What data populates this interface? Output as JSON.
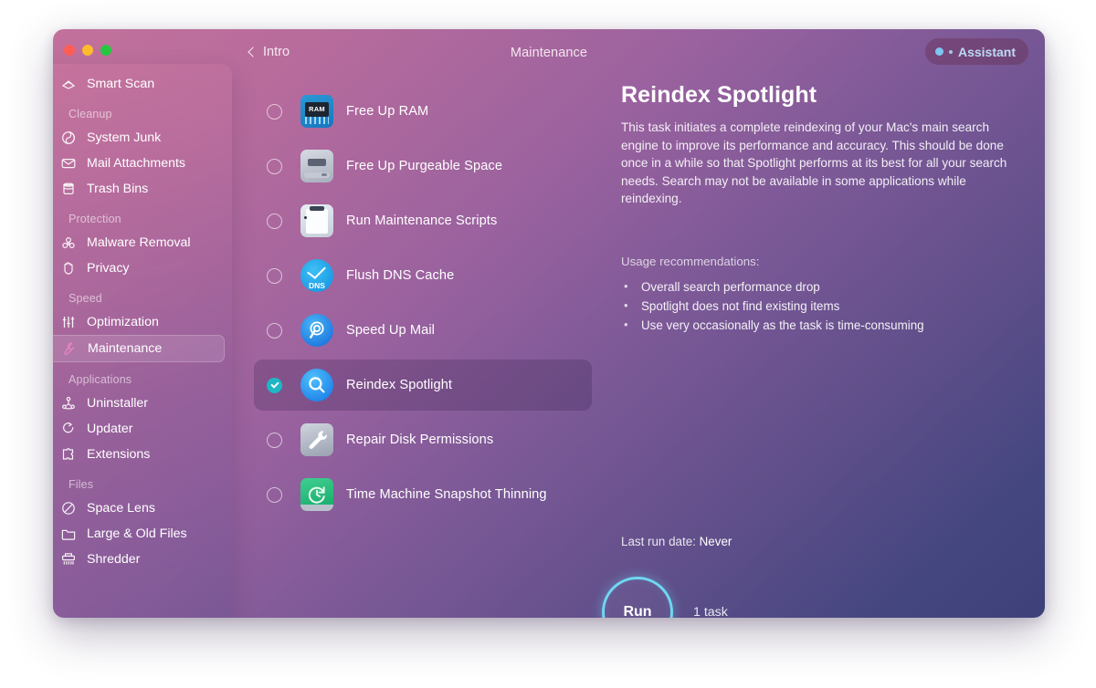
{
  "window": {
    "title": "Maintenance",
    "back_label": "Intro",
    "assistant_label": "Assistant",
    "traffic_lights": [
      "close-button",
      "minimize-button",
      "zoom-button"
    ],
    "accent_color": "#6fd7f2",
    "checkbox_color": "#1fb6c6"
  },
  "sidebar": {
    "top_item": {
      "label": "Smart Scan",
      "icon": "smart-scan-icon"
    },
    "groups": [
      {
        "label": "Cleanup",
        "items": [
          {
            "label": "System Junk",
            "icon": "system-junk-icon"
          },
          {
            "label": "Mail Attachments",
            "icon": "mail-icon"
          },
          {
            "label": "Trash Bins",
            "icon": "trash-icon"
          }
        ]
      },
      {
        "label": "Protection",
        "items": [
          {
            "label": "Malware Removal",
            "icon": "biohazard-icon"
          },
          {
            "label": "Privacy",
            "icon": "hand-icon"
          }
        ]
      },
      {
        "label": "Speed",
        "items": [
          {
            "label": "Optimization",
            "icon": "sliders-icon"
          },
          {
            "label": "Maintenance",
            "icon": "wrench-icon",
            "selected": true
          }
        ]
      },
      {
        "label": "Applications",
        "items": [
          {
            "label": "Uninstaller",
            "icon": "uninstaller-icon"
          },
          {
            "label": "Updater",
            "icon": "updater-icon"
          },
          {
            "label": "Extensions",
            "icon": "puzzle-icon"
          }
        ]
      },
      {
        "label": "Files",
        "items": [
          {
            "label": "Space Lens",
            "icon": "space-lens-icon"
          },
          {
            "label": "Large & Old Files",
            "icon": "folder-icon"
          },
          {
            "label": "Shredder",
            "icon": "shredder-icon"
          }
        ]
      }
    ]
  },
  "tasks": [
    {
      "label": "Free Up RAM",
      "icon": "ram-icon",
      "checked": false,
      "selected": false
    },
    {
      "label": "Free Up Purgeable Space",
      "icon": "disk-icon",
      "checked": false,
      "selected": false
    },
    {
      "label": "Run Maintenance Scripts",
      "icon": "script-clipboard-icon",
      "checked": false,
      "selected": false
    },
    {
      "label": "Flush DNS Cache",
      "icon": "dns-icon",
      "checked": false,
      "selected": false
    },
    {
      "label": "Speed Up Mail",
      "icon": "speed-up-mail-icon",
      "checked": false,
      "selected": false
    },
    {
      "label": "Reindex Spotlight",
      "icon": "spotlight-search-icon",
      "checked": true,
      "selected": true
    },
    {
      "label": "Repair Disk Permissions",
      "icon": "disk-wrench-icon",
      "checked": false,
      "selected": false
    },
    {
      "label": "Time Machine Snapshot Thinning",
      "icon": "time-machine-icon",
      "checked": false,
      "selected": false
    }
  ],
  "detail": {
    "title": "Reindex Spotlight",
    "description": "This task initiates a complete reindexing of your Mac's main search engine to improve its performance and accuracy. This should be done once in a while so that Spotlight performs at its best for all your search needs. Search may not be available in some applications while reindexing.",
    "usage_label": "Usage recommendations:",
    "usage_items": [
      "Overall search performance drop",
      "Spotlight does not find existing items",
      "Use very occasionally as the task is time-consuming"
    ],
    "last_run_label": "Last run date:",
    "last_run_value": "Never"
  },
  "footer": {
    "run_label": "Run",
    "task_count": "1 task"
  }
}
